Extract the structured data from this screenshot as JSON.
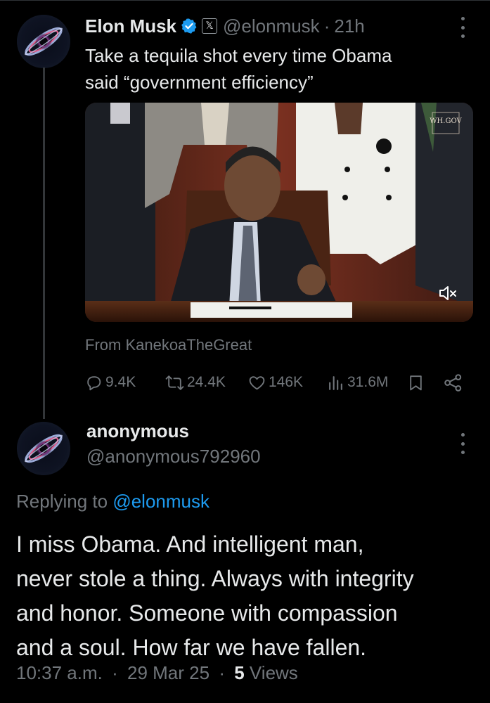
{
  "tweet": {
    "author_name": "Elon Musk",
    "handle": "@elonmusk",
    "separator": "·",
    "time": "21h",
    "badge_glyph": "𝕏",
    "text_line1": "Take a tequila shot every time Obama",
    "text_line2": "said “government efficiency”",
    "media_watermark": "WH.GOV",
    "from_label": "From KanekoaTheGreat",
    "stats": {
      "replies": "9.4K",
      "reposts": "24.4K",
      "likes": "146K",
      "views": "31.6M"
    }
  },
  "reply": {
    "user_name": "anonymous",
    "handle": "@anonymous792960",
    "replying_prefix": "Replying to ",
    "replying_handle": "@elonmusk",
    "text_line1": "I miss Obama. And intelligent man,",
    "text_line2": "never stole a thing. Always with integrity",
    "text_line3": "and honor. Someone with compassion",
    "text_line4": "and a soul.  How far we have fallen.",
    "time": "10:37 a.m.",
    "sep1": "·",
    "date": "29 Mar 25",
    "sep2": "·",
    "views_count": "5",
    "views_label": "Views"
  },
  "colors": {
    "background": "#000000",
    "text": "#e7e9ea",
    "muted": "#71767b",
    "link": "#1d9bf0",
    "verified": "#1d9bf0"
  },
  "icons": [
    "verified-badge-icon",
    "x-affiliate-icon",
    "more-icon",
    "mute-icon",
    "reply-icon",
    "repost-icon",
    "like-icon",
    "views-icon",
    "bookmark-icon",
    "share-icon"
  ]
}
